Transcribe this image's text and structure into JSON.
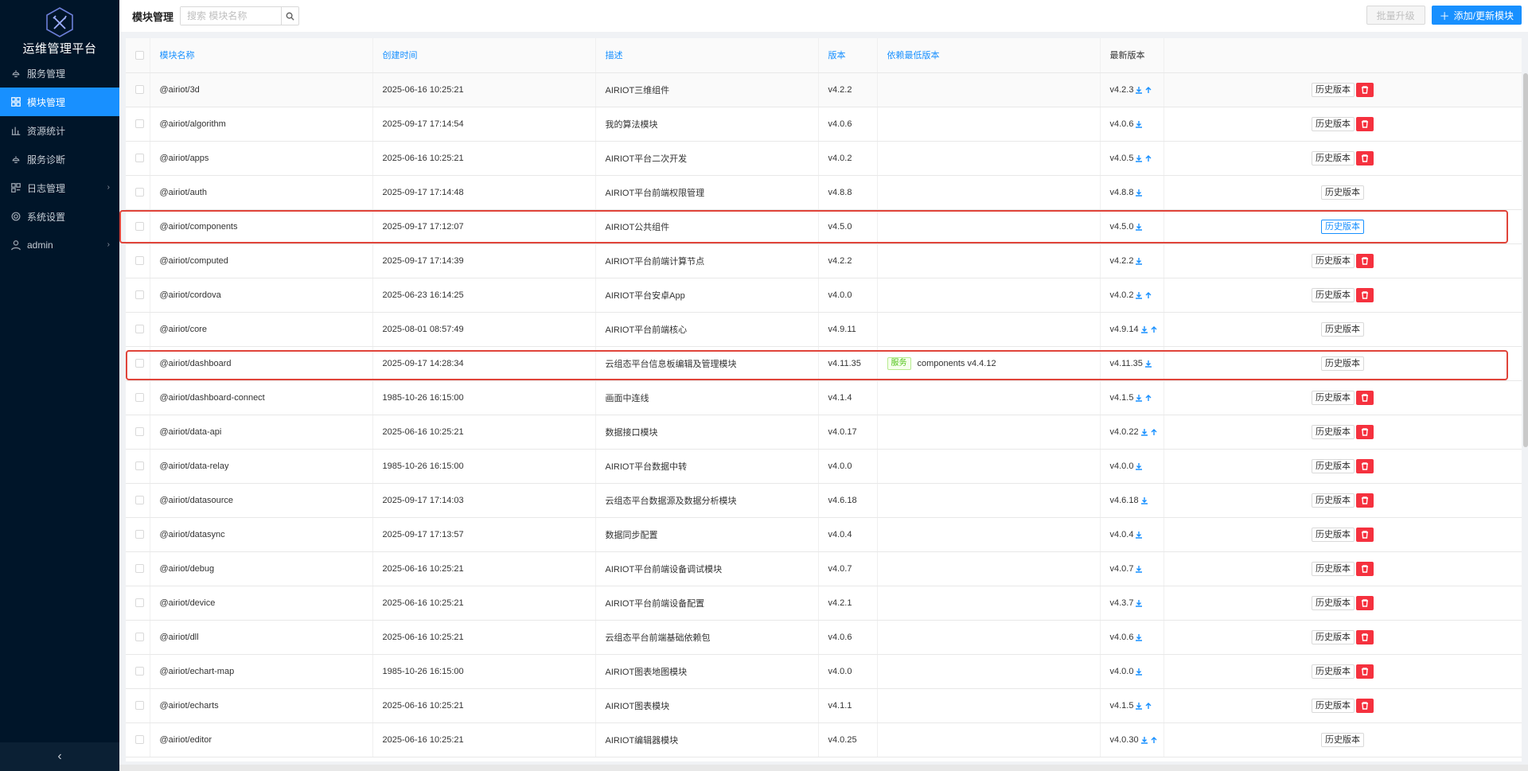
{
  "app": {
    "title": "运维管理平台"
  },
  "sidebar": {
    "items": [
      {
        "label": "服务管理",
        "icon": "service-icon",
        "active": false,
        "arrow": false
      },
      {
        "label": "模块管理",
        "icon": "module-icon",
        "active": true,
        "arrow": false
      },
      {
        "label": "资源统计",
        "icon": "chart-icon",
        "active": false,
        "arrow": false
      },
      {
        "label": "服务诊断",
        "icon": "diagnose-icon",
        "active": false,
        "arrow": false
      },
      {
        "label": "日志管理",
        "icon": "log-icon",
        "active": false,
        "arrow": true
      },
      {
        "label": "系统设置",
        "icon": "gear-icon",
        "active": false,
        "arrow": false
      },
      {
        "label": "admin",
        "icon": "user-icon",
        "active": false,
        "arrow": true
      }
    ],
    "collapse": "‹"
  },
  "header": {
    "title": "模块管理",
    "search_placeholder": "搜索 模块名称",
    "batch_label": "批量升级",
    "add_label": "添加/更新模块"
  },
  "table": {
    "columns": [
      "模块名称",
      "创建时间",
      "描述",
      "版本",
      "依赖最低版本",
      "最新版本",
      ""
    ],
    "rows": [
      {
        "name": "@airiot/3d",
        "created": "2025-06-16 10:25:21",
        "desc": "AIRIOT三维组件",
        "version": "v4.2.2",
        "dep_tag": "",
        "dep": "",
        "latest": "v4.2.3",
        "download": true,
        "upgrade": true,
        "hist": "历史版本",
        "del": true,
        "hl": false
      },
      {
        "name": "@airiot/algorithm",
        "created": "2025-09-17 17:14:54",
        "desc": "我的算法模块",
        "version": "v4.0.6",
        "dep_tag": "",
        "dep": "",
        "latest": "v4.0.6",
        "download": true,
        "upgrade": false,
        "hist": "历史版本",
        "del": true,
        "hl": false
      },
      {
        "name": "@airiot/apps",
        "created": "2025-06-16 10:25:21",
        "desc": "AIRIOT平台二次开发",
        "version": "v4.0.2",
        "dep_tag": "",
        "dep": "",
        "latest": "v4.0.5",
        "download": true,
        "upgrade": true,
        "hist": "历史版本",
        "del": true,
        "hl": false
      },
      {
        "name": "@airiot/auth",
        "created": "2025-09-17 17:14:48",
        "desc": "AIRIOT平台前端权限管理",
        "version": "v4.8.8",
        "dep_tag": "",
        "dep": "",
        "latest": "v4.8.8",
        "download": true,
        "upgrade": false,
        "hist": "历史版本",
        "del": false,
        "hl": false
      },
      {
        "name": "@airiot/components",
        "created": "2025-09-17 17:12:07",
        "desc": "AIRIOT公共组件",
        "version": "v4.5.0",
        "dep_tag": "",
        "dep": "",
        "latest": "v4.5.0",
        "download": true,
        "upgrade": false,
        "hist": "历史版本",
        "del": false,
        "hl": true
      },
      {
        "name": "@airiot/computed",
        "created": "2025-09-17 17:14:39",
        "desc": "AIRIOT平台前端计算节点",
        "version": "v4.2.2",
        "dep_tag": "",
        "dep": "",
        "latest": "v4.2.2",
        "download": true,
        "upgrade": false,
        "hist": "历史版本",
        "del": true,
        "hl": false
      },
      {
        "name": "@airiot/cordova",
        "created": "2025-06-23 16:14:25",
        "desc": "AIRIOT平台安卓App",
        "version": "v4.0.0",
        "dep_tag": "",
        "dep": "",
        "latest": "v4.0.2",
        "download": true,
        "upgrade": true,
        "hist": "历史版本",
        "del": true,
        "hl": false
      },
      {
        "name": "@airiot/core",
        "created": "2025-08-01 08:57:49",
        "desc": "AIRIOT平台前端核心",
        "version": "v4.9.11",
        "dep_tag": "",
        "dep": "",
        "latest": "v4.9.14",
        "download": true,
        "upgrade": true,
        "hist": "历史版本",
        "del": false,
        "hl": false
      },
      {
        "name": "@airiot/dashboard",
        "created": "2025-09-17 14:28:34",
        "desc": "云组态平台信息板编辑及管理模块",
        "version": "v4.11.35",
        "dep_tag": "服务",
        "dep": "components v4.4.12",
        "latest": "v4.11.35",
        "download": true,
        "upgrade": false,
        "hist": "历史版本",
        "del": false,
        "hl": false
      },
      {
        "name": "@airiot/dashboard-connect",
        "created": "1985-10-26 16:15:00",
        "desc": "画面中连线",
        "version": "v4.1.4",
        "dep_tag": "",
        "dep": "",
        "latest": "v4.1.5",
        "download": true,
        "upgrade": true,
        "hist": "历史版本",
        "del": true,
        "hl": false
      },
      {
        "name": "@airiot/data-api",
        "created": "2025-06-16 10:25:21",
        "desc": "数据接口模块",
        "version": "v4.0.17",
        "dep_tag": "",
        "dep": "",
        "latest": "v4.0.22",
        "download": true,
        "upgrade": true,
        "hist": "历史版本",
        "del": true,
        "hl": false
      },
      {
        "name": "@airiot/data-relay",
        "created": "1985-10-26 16:15:00",
        "desc": "AIRIOT平台数据中转",
        "version": "v4.0.0",
        "dep_tag": "",
        "dep": "",
        "latest": "v4.0.0",
        "download": true,
        "upgrade": false,
        "hist": "历史版本",
        "del": true,
        "hl": false
      },
      {
        "name": "@airiot/datasource",
        "created": "2025-09-17 17:14:03",
        "desc": "云组态平台数据源及数据分析模块",
        "version": "v4.6.18",
        "dep_tag": "",
        "dep": "",
        "latest": "v4.6.18",
        "download": true,
        "upgrade": false,
        "hist": "历史版本",
        "del": true,
        "hl": false
      },
      {
        "name": "@airiot/datasync",
        "created": "2025-09-17 17:13:57",
        "desc": "数据同步配置",
        "version": "v4.0.4",
        "dep_tag": "",
        "dep": "",
        "latest": "v4.0.4",
        "download": true,
        "upgrade": false,
        "hist": "历史版本",
        "del": true,
        "hl": false
      },
      {
        "name": "@airiot/debug",
        "created": "2025-06-16 10:25:21",
        "desc": "AIRIOT平台前端设备调试模块",
        "version": "v4.0.7",
        "dep_tag": "",
        "dep": "",
        "latest": "v4.0.7",
        "download": true,
        "upgrade": false,
        "hist": "历史版本",
        "del": true,
        "hl": false
      },
      {
        "name": "@airiot/device",
        "created": "2025-06-16 10:25:21",
        "desc": "AIRIOT平台前端设备配置",
        "version": "v4.2.1",
        "dep_tag": "",
        "dep": "",
        "latest": "v4.3.7",
        "download": true,
        "upgrade": false,
        "hist": "历史版本",
        "del": true,
        "hl": false
      },
      {
        "name": "@airiot/dll",
        "created": "2025-06-16 10:25:21",
        "desc": "云组态平台前端基础依赖包",
        "version": "v4.0.6",
        "dep_tag": "",
        "dep": "",
        "latest": "v4.0.6",
        "download": true,
        "upgrade": false,
        "hist": "历史版本",
        "del": true,
        "hl": false
      },
      {
        "name": "@airiot/echart-map",
        "created": "1985-10-26 16:15:00",
        "desc": "AIRIOT图表地图模块",
        "version": "v4.0.0",
        "dep_tag": "",
        "dep": "",
        "latest": "v4.0.0",
        "download": true,
        "upgrade": false,
        "hist": "历史版本",
        "del": true,
        "hl": false
      },
      {
        "name": "@airiot/echarts",
        "created": "2025-06-16 10:25:21",
        "desc": "AIRIOT图表模块",
        "version": "v4.1.1",
        "dep_tag": "",
        "dep": "",
        "latest": "v4.1.5",
        "download": true,
        "upgrade": true,
        "hist": "历史版本",
        "del": true,
        "hl": false
      },
      {
        "name": "@airiot/editor",
        "created": "2025-06-16 10:25:21",
        "desc": "AIRIOT编辑器模块",
        "version": "v4.0.25",
        "dep_tag": "",
        "dep": "",
        "latest": "v4.0.30",
        "download": true,
        "upgrade": true,
        "hist": "历史版本",
        "del": false,
        "hl": false
      }
    ]
  },
  "colors": {
    "sidebar_bg": "#001529",
    "accent": "#1890ff",
    "danger": "#f5313e",
    "highlight_box": "#e0443a"
  }
}
